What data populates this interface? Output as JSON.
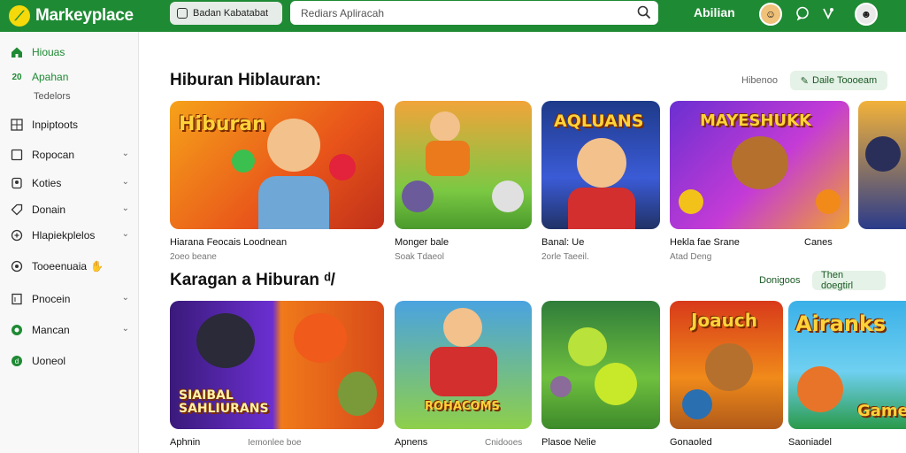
{
  "app": {
    "name": "Markeyplace",
    "logo_icon": "leaf-logo-icon",
    "brand_color": "#1f8a34"
  },
  "topbar": {
    "category_label": "Badan Kabatabat",
    "search_placeholder": "Rediars Apliracah",
    "account_label": "Abilian"
  },
  "sidebar": {
    "items": [
      {
        "label": "Hiouas",
        "icon": "home-icon",
        "active": true,
        "chevron": false
      },
      {
        "label": "Apahan",
        "icon": "apps-icon",
        "active": true,
        "chevron": false
      },
      {
        "label": "Tedelors",
        "sub": true
      },
      {
        "label": "Inpiptoots",
        "icon": "grid-icon",
        "chevron": false
      },
      {
        "label": "Ropocan",
        "icon": "box-icon",
        "chevron": true
      },
      {
        "label": "Koties",
        "icon": "badge-icon",
        "chevron": true
      },
      {
        "label": "Donain",
        "icon": "tag-icon",
        "chevron": true
      },
      {
        "label": "Hlapiekplelos",
        "icon": "puzzle-icon",
        "chevron": true
      },
      {
        "label": "Tooeenuaia",
        "icon": "settings-icon",
        "chevron": false
      },
      {
        "label": "Pnocein",
        "icon": "doc-icon",
        "chevron": true
      },
      {
        "label": "Mancan",
        "icon": "circle-icon",
        "chevron": true
      },
      {
        "label": "Uoneol",
        "icon": "coin-icon",
        "chevron": false
      }
    ]
  },
  "section1": {
    "title": "Hiburan Hiblauran:",
    "link_label": "Hibenoo",
    "button_label": "Daile Toooeam",
    "cards": [
      {
        "art_text": "Hiburan",
        "title": "Hiarana Feocais Loodnean",
        "sub": "2oeo beane"
      },
      {
        "art_text": "",
        "title": "Monger bale",
        "sub": "Soak Tdaeol"
      },
      {
        "art_text": "AQLUANS",
        "title": "Banal: Ue",
        "sub": "2orle Taeeil."
      },
      {
        "art_text": "MAYESHUKK",
        "title": "Hekla fae Srane",
        "sub": "Atad Deng"
      },
      {
        "art_text": "",
        "title": "Canes",
        "sub": ""
      }
    ]
  },
  "section2": {
    "title": "Karagan a Hiburan ᵈ/",
    "link_label": "Donigoos",
    "button_label": "Then doegtirl",
    "cards": [
      {
        "art_text": "SIAIBAL SAHLIURANS",
        "title": "Aphnin",
        "sub": "Iemonlee boe"
      },
      {
        "art_text": "ROHACOMS",
        "title": "Apnens",
        "sub": "Cnidooes"
      },
      {
        "art_text": "",
        "title": "Plasoe Nelie",
        "sub": ""
      },
      {
        "art_text": "Joauch",
        "title": "Gonaoled",
        "sub": ""
      },
      {
        "art_text": "Airanks",
        "title": "Saoniadel",
        "sub": ""
      }
    ]
  }
}
